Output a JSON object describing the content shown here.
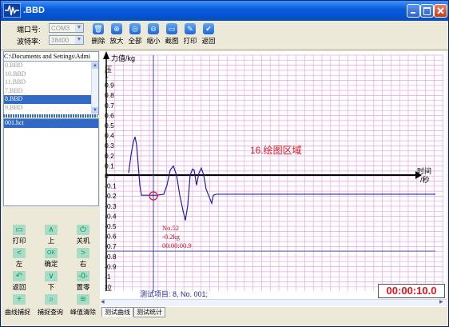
{
  "window": {
    "title": ".BBD",
    "icon": "waveform-icon",
    "controls": [
      "minimize-icon",
      "maximize-icon",
      "close-icon"
    ]
  },
  "settings": {
    "port_label": "端口号:",
    "port_value": "COM3",
    "baud_label": "波特率:",
    "baud_value": "38400"
  },
  "toolbar": {
    "tools": [
      {
        "label": "删除",
        "icon": "trash-icon"
      },
      {
        "label": "放大",
        "icon": "zoom-in-icon"
      },
      {
        "label": "全部",
        "icon": "zoom-all-icon"
      },
      {
        "label": "缩小",
        "icon": "zoom-out-icon"
      },
      {
        "label": "截图",
        "icon": "screenshot-icon"
      },
      {
        "label": "打印",
        "icon": "print-icon"
      },
      {
        "label": "返回",
        "icon": "back-icon"
      }
    ]
  },
  "sidebar": {
    "path": "C:\\Documents and Settings\\Admi",
    "files": [
      {
        "name": "0.BBD",
        "selected": false
      },
      {
        "name": "10.BBD",
        "selected": false
      },
      {
        "name": "11.BBD",
        "selected": false
      },
      {
        "name": "7.BBD",
        "selected": false
      },
      {
        "name": "8.BBD",
        "selected": true
      },
      {
        "name": "9.BBD",
        "selected": false
      }
    ],
    "tests": [
      {
        "name": "001.hct",
        "selected": true
      }
    ]
  },
  "keypad": [
    {
      "label": "打印",
      "icon": "monitor-icon"
    },
    {
      "label": "上",
      "icon": "arrow-up-icon"
    },
    {
      "label": "关机",
      "icon": "power-icon"
    },
    {
      "label": "左",
      "icon": "arrow-left-icon"
    },
    {
      "label": "确定",
      "icon": "ok-icon"
    },
    {
      "label": "右",
      "icon": "arrow-right-icon"
    },
    {
      "label": "返回",
      "icon": "return-icon"
    },
    {
      "label": "下",
      "icon": "arrow-down-icon"
    },
    {
      "label": "置零",
      "icon": "zero-icon"
    }
  ],
  "bottom_buttons": [
    "曲线捕捉",
    "捕捉查询",
    "峰值清除"
  ],
  "plot": {
    "ylabel": "力值/kg",
    "xlabel_1": "时间",
    "xlabel_2": "/秒",
    "top_label": "压",
    "bottom_label": "拉",
    "y_ticks": [
      "1",
      "0.9",
      "0.8",
      "0.7",
      "0.6",
      "0.5",
      "0.4",
      "0.3",
      "0.2",
      "0.1",
      "0",
      "-0.1",
      "-0.2",
      "-0.3",
      "-0.4",
      "-0.5",
      "-0.6",
      "-0.7",
      "-0.8",
      "-0.9",
      "-1"
    ],
    "region_label": "16.绘图区域",
    "cursor_info": [
      "No.52",
      "-0.2kg",
      "00:00:00.9"
    ],
    "test_item": "测试项目: 8, No. 001;",
    "timer": "00:00:10.0",
    "colors": {
      "grid": "#e8a6e6",
      "curve": "#1f1fa6",
      "axis": "#000000",
      "accent": "#e0141e"
    }
  },
  "tabs": [
    "测试曲线",
    "测试统计"
  ]
}
